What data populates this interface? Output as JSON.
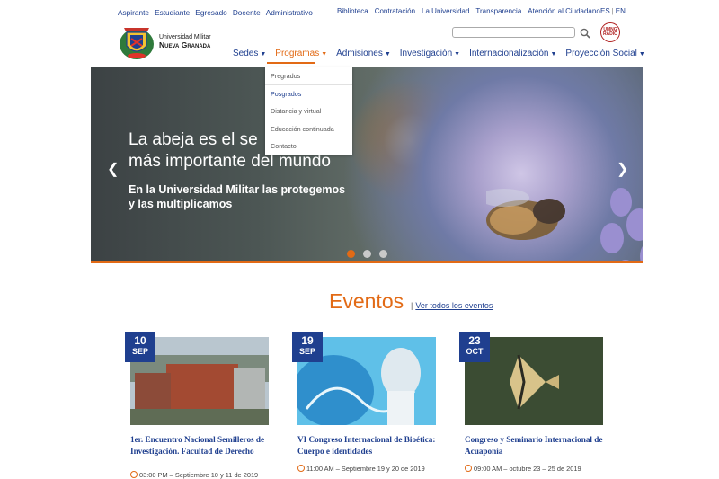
{
  "top_links_left": [
    "Aspirante",
    "Estudiante",
    "Egresado",
    "Docente",
    "Administrativo"
  ],
  "top_links_right": [
    "Biblioteca",
    "Contratación",
    "La Universidad",
    "Transparencia",
    "Atención al Ciudadano"
  ],
  "languages": [
    "ES",
    "EN"
  ],
  "logo": {
    "line1": "Universidad Militar",
    "line2": "Nueva Granada"
  },
  "radio_badge": {
    "line1": "UMNG",
    "line2": "RADIO"
  },
  "search": {
    "placeholder": ""
  },
  "main_nav": [
    {
      "label": "Sedes",
      "active": false
    },
    {
      "label": "Programas",
      "active": true
    },
    {
      "label": "Admisiones",
      "active": false
    },
    {
      "label": "Investigación",
      "active": false
    },
    {
      "label": "Internacionalización",
      "active": false
    },
    {
      "label": "Proyección Social",
      "active": false
    }
  ],
  "dropdown": [
    "Pregrados",
    "Posgrados",
    "Distancia y virtual",
    "Educación continuada",
    "Contacto"
  ],
  "hero": {
    "title_line1": "La abeja es el se",
    "title_line2": "más importante del mundo",
    "sub_line1": "En la Universidad Militar las protegemos",
    "sub_line2": "y las multiplicamos",
    "slides": 3,
    "active_slide": 1
  },
  "events": {
    "title": "Eventos",
    "view_all": "Ver todos los eventos",
    "items": [
      {
        "day": "10",
        "month": "SEP",
        "title": "1er. Encuentro Nacional Semilleros de Investigación. Facultad de Derecho",
        "time": "03:00 PM – Septiembre 10 y 11 de 2019"
      },
      {
        "day": "19",
        "month": "SEP",
        "title": "VI Congreso Internacional de Bioética: Cuerpo e identidades",
        "time": "11:00 AM – Septiembre 19 y 20 de 2019"
      },
      {
        "day": "23",
        "month": "OCT",
        "title": "Congreso y Seminario Internacional de Acuaponía",
        "time": "09:00 AM – octubre 23 – 25 de 2019"
      }
    ]
  },
  "colors": {
    "accent": "#e26a15",
    "brand": "#1f3f8f"
  }
}
